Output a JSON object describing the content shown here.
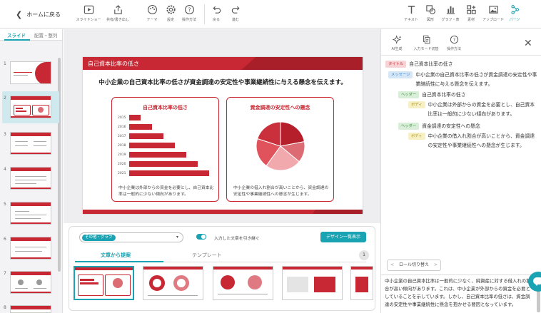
{
  "toolbar": {
    "back_label": "ホームに戻る",
    "left_items": [
      {
        "label": "スライドショー",
        "icon": "play-icon"
      },
      {
        "label": "共有/書き出し",
        "icon": "share-icon"
      },
      {
        "label": "テーマ",
        "icon": "palette-icon"
      },
      {
        "label": "設定",
        "icon": "gear-icon"
      },
      {
        "label": "操作方法",
        "icon": "help-icon"
      },
      {
        "label": "戻る",
        "icon": "undo-icon"
      },
      {
        "label": "進む",
        "icon": "redo-icon"
      }
    ],
    "right_items": [
      {
        "label": "テキスト",
        "icon": "text-icon"
      },
      {
        "label": "図形",
        "icon": "shape-icon"
      },
      {
        "label": "グラフ・表",
        "icon": "chart-icon"
      },
      {
        "label": "素材",
        "icon": "material-icon"
      },
      {
        "label": "アップロード",
        "icon": "image-upload-icon"
      },
      {
        "label": "パーツ",
        "icon": "parts-icon"
      }
    ],
    "active_color": "#1aa3b2"
  },
  "left_panel": {
    "tabs": [
      "スライド",
      "配置・整列"
    ],
    "active_tab": 0,
    "slide_numbers": [
      "1",
      "2",
      "3",
      "4",
      "5",
      "6",
      "7",
      "8"
    ],
    "selected_slide": "2"
  },
  "slide": {
    "title": "自己資本比率の低さ",
    "message": "中小企業の自己資本比率の低さが資金調達の安定性や事業継続性に与える懸念を伝えます。",
    "left_card": {
      "heading": "自己資本比率の低さ",
      "body": "中小企業は外部からの資金を必要とし、自己資本比率は一般的に少ない傾向があります。",
      "bars": [
        {
          "label": "2015",
          "value": 1
        },
        {
          "label": "2016",
          "value": 2
        },
        {
          "label": "2017",
          "value": 3
        },
        {
          "label": "2018",
          "value": 4
        },
        {
          "label": "2019",
          "value": 5
        },
        {
          "label": "2020",
          "value": 6
        },
        {
          "label": "2021",
          "value": 7
        }
      ]
    },
    "right_card": {
      "heading": "資金調達の安定性への懸念",
      "body": "中小企業の借入れ割合が高いことから、資金調達の安定性や事業継続性への懸念が生じます。",
      "pie": [
        {
          "value": 22,
          "color": "#b51f2b"
        },
        {
          "value": 14,
          "color": "#dc6b73"
        },
        {
          "value": 24,
          "color": "#f2a9ae"
        },
        {
          "value": 20,
          "color": "#e0535d"
        },
        {
          "value": 20,
          "color": "#c9303b"
        }
      ]
    },
    "brand_color": "#c72833"
  },
  "design_panel": {
    "category_chip": "その他・グラフ",
    "caret": "▾",
    "toggle_label": "入力した文章を引き継ぐ",
    "toggle_on": true,
    "list_button": "デザイン一覧表示",
    "tabs": [
      "文章から提案",
      "テンプレート"
    ],
    "active_tab": 0,
    "count": "1"
  },
  "right_panel": {
    "tools": [
      {
        "label": "AI生成",
        "icon": "ai-sparkle-icon"
      },
      {
        "label": "入力モード切替",
        "icon": "document-switch-icon"
      },
      {
        "label": "操作方法",
        "icon": "help-icon"
      }
    ],
    "rows": [
      {
        "tag": "タイトル",
        "kind": "title",
        "text": "自己資本比率の低さ"
      },
      {
        "tag": "メッセージ",
        "kind": "msg",
        "text": "中小企業の自己資本比率の低さが資金調達の安定性や事業継続性に与える懸念を伝えます。"
      },
      {
        "tag": "ヘッダー",
        "kind": "head",
        "text": "自己資本比率の低さ"
      },
      {
        "tag": "ボディ",
        "kind": "body",
        "text": "中小企業は外部からの資金を必要とし、自己資本比率は一般的に少ない傾向があります。"
      },
      {
        "tag": "ヘッダー",
        "kind": "head",
        "text": "資金調達の安定性への懸念"
      },
      {
        "tag": "ボディ",
        "kind": "body",
        "text": "中小企業の借入れ割合が高いことから、資金調達の安定性や事業継続性への懸念が生じます。"
      }
    ],
    "role_switch": "ロール切り替え",
    "role_prev": "<",
    "role_next": ">",
    "bottom_text": "中小企業の自己資本比率は一般的に少なく、純資産に対する借入れの割合が高い傾向があります。これは、中小企業が外部からの資金を必要としていることを示しています。しかし、自己資本比率の低さは、資金調達の安定性や事業継続性に懸念を抱かせる要因となっています。"
  }
}
